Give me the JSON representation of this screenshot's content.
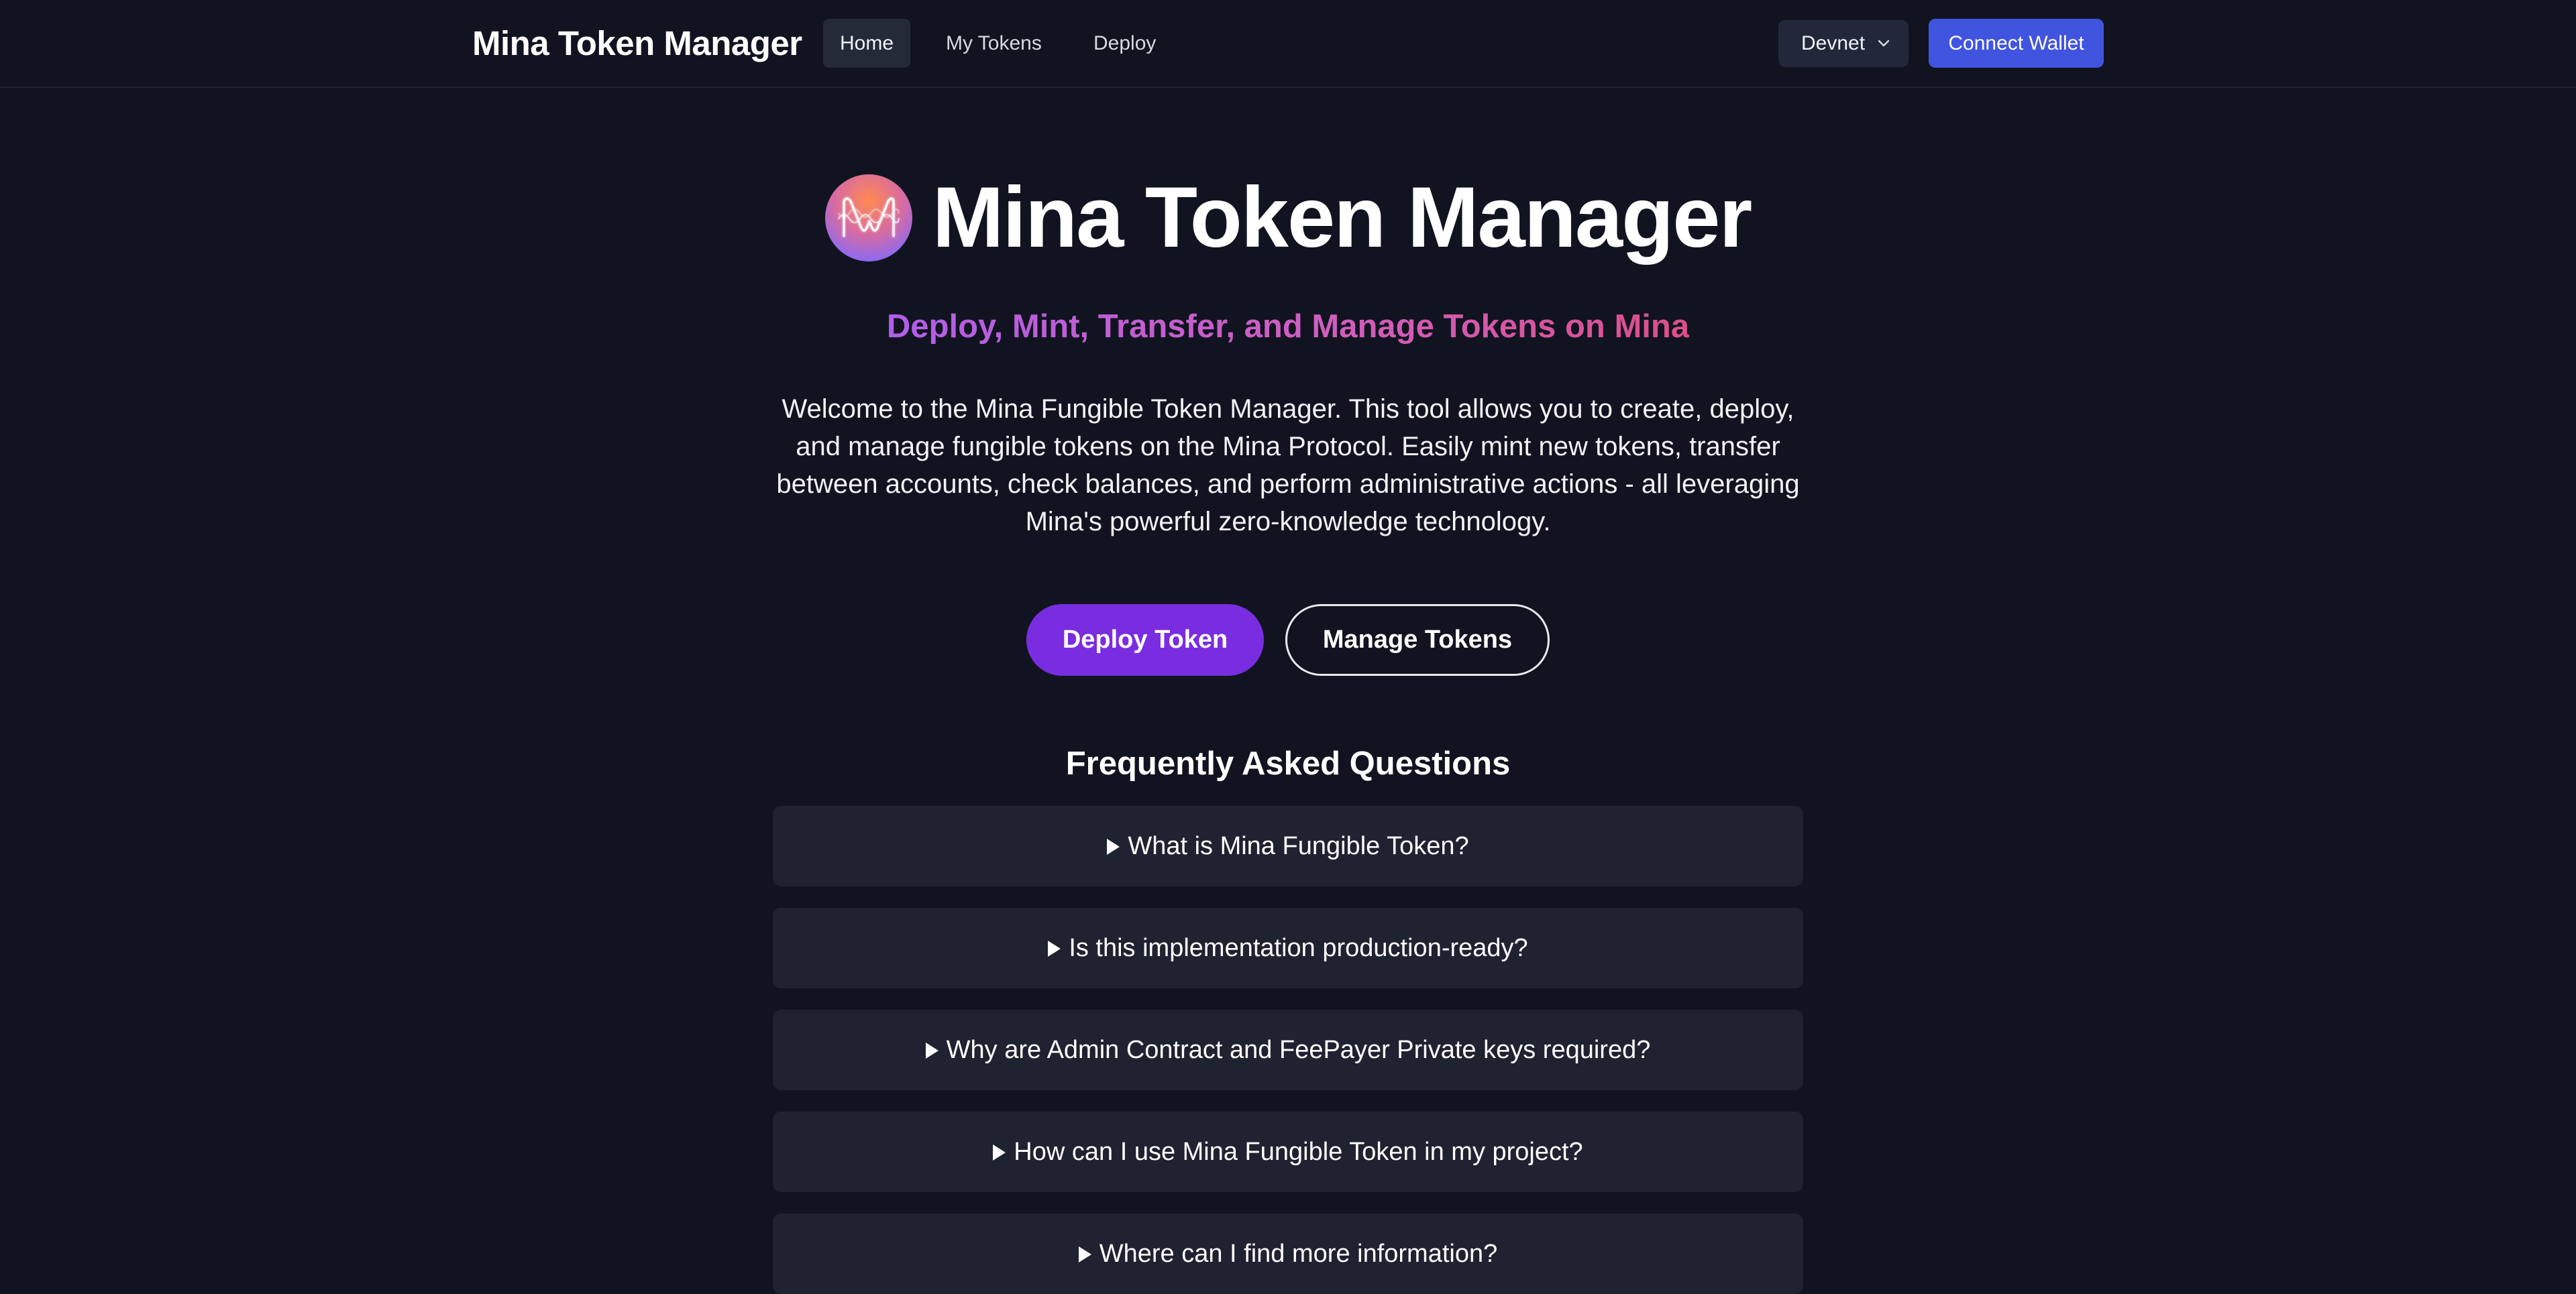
{
  "header": {
    "brand": "Mina Token Manager",
    "nav": [
      {
        "label": "Home",
        "active": true
      },
      {
        "label": "My Tokens",
        "active": false
      },
      {
        "label": "Deploy",
        "active": false
      }
    ],
    "network_select": {
      "value": "Devnet",
      "icon": "chevron-down-icon"
    },
    "connect_label": "Connect Wallet"
  },
  "hero": {
    "logo_icon": "mina-logo-icon",
    "title": "Mina Token Manager",
    "tagline": "Deploy, Mint, Transfer, and Manage Tokens on Mina",
    "intro": "Welcome to the Mina Fungible Token Manager. This tool allows you to create, deploy, and manage fungible tokens on the Mina Protocol. Easily mint new tokens, transfer between accounts, check balances, and perform administrative actions - all leveraging Mina's powerful zero-knowledge technology."
  },
  "actions": {
    "primary": "Deploy Token",
    "secondary": "Manage Tokens"
  },
  "faq": {
    "title": "Frequently Asked Questions",
    "items": [
      "What is Mina Fungible Token?",
      "Is this implementation production-ready?",
      "Why are Admin Contract and FeePayer Private keys required?",
      "How can I use Mina Fungible Token in my project?",
      "Where can I find more information?"
    ]
  },
  "colors": {
    "background": "#111420",
    "accent_purple": "#7a2de0",
    "connect_blue": "#4154e0",
    "faq_card": "#1f2230"
  }
}
